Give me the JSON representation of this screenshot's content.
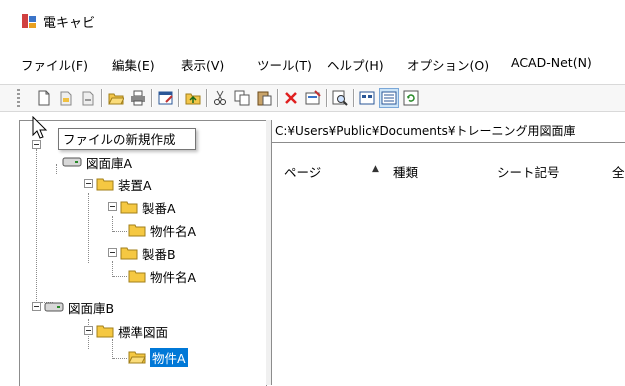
{
  "window": {
    "title": "電キャビ"
  },
  "menu": [
    "ファイル(F)",
    "編集(E)",
    "表示(V)",
    "ツール(T)",
    "ヘルプ(H)",
    "オプション(O)",
    "ACAD-Net(N)"
  ],
  "toolbar": {
    "buttons": [
      "new-file-icon",
      "open-file-icon",
      "close-file-icon",
      "open-folder-icon",
      "print-icon",
      "edit-properties-icon",
      "folder-up-icon",
      "cut-icon",
      "copy-icon",
      "paste-icon",
      "delete-icon",
      "properties-icon",
      "search-icon",
      "view-list-icon",
      "view-details-icon",
      "refresh-icon"
    ]
  },
  "tooltip": "ファイルの新規作成",
  "tree": {
    "nodes": [
      {
        "label": "図面庫A",
        "icon": "drive-icon"
      },
      {
        "label": "装置A",
        "icon": "folder-icon"
      },
      {
        "label": "製番A",
        "icon": "folder-icon"
      },
      {
        "label": "物件名A",
        "icon": "folder-icon"
      },
      {
        "label": "製番B",
        "icon": "folder-icon"
      },
      {
        "label": "物件名A",
        "icon": "folder-icon"
      },
      {
        "label": "図面庫B",
        "icon": "drive-icon"
      },
      {
        "label": "標準図面",
        "icon": "folder-icon"
      },
      {
        "label": "物件A",
        "icon": "open-folder-icon",
        "selected": true
      }
    ]
  },
  "list": {
    "path": "C:¥Users¥Public¥Documents¥トレーニング用図面庫",
    "columns": [
      "ページ",
      "種類",
      "シート記号",
      "全"
    ],
    "sort_indicator": "▲"
  },
  "colors": {
    "selection": "#0078d7",
    "folder": "#f5c842"
  }
}
